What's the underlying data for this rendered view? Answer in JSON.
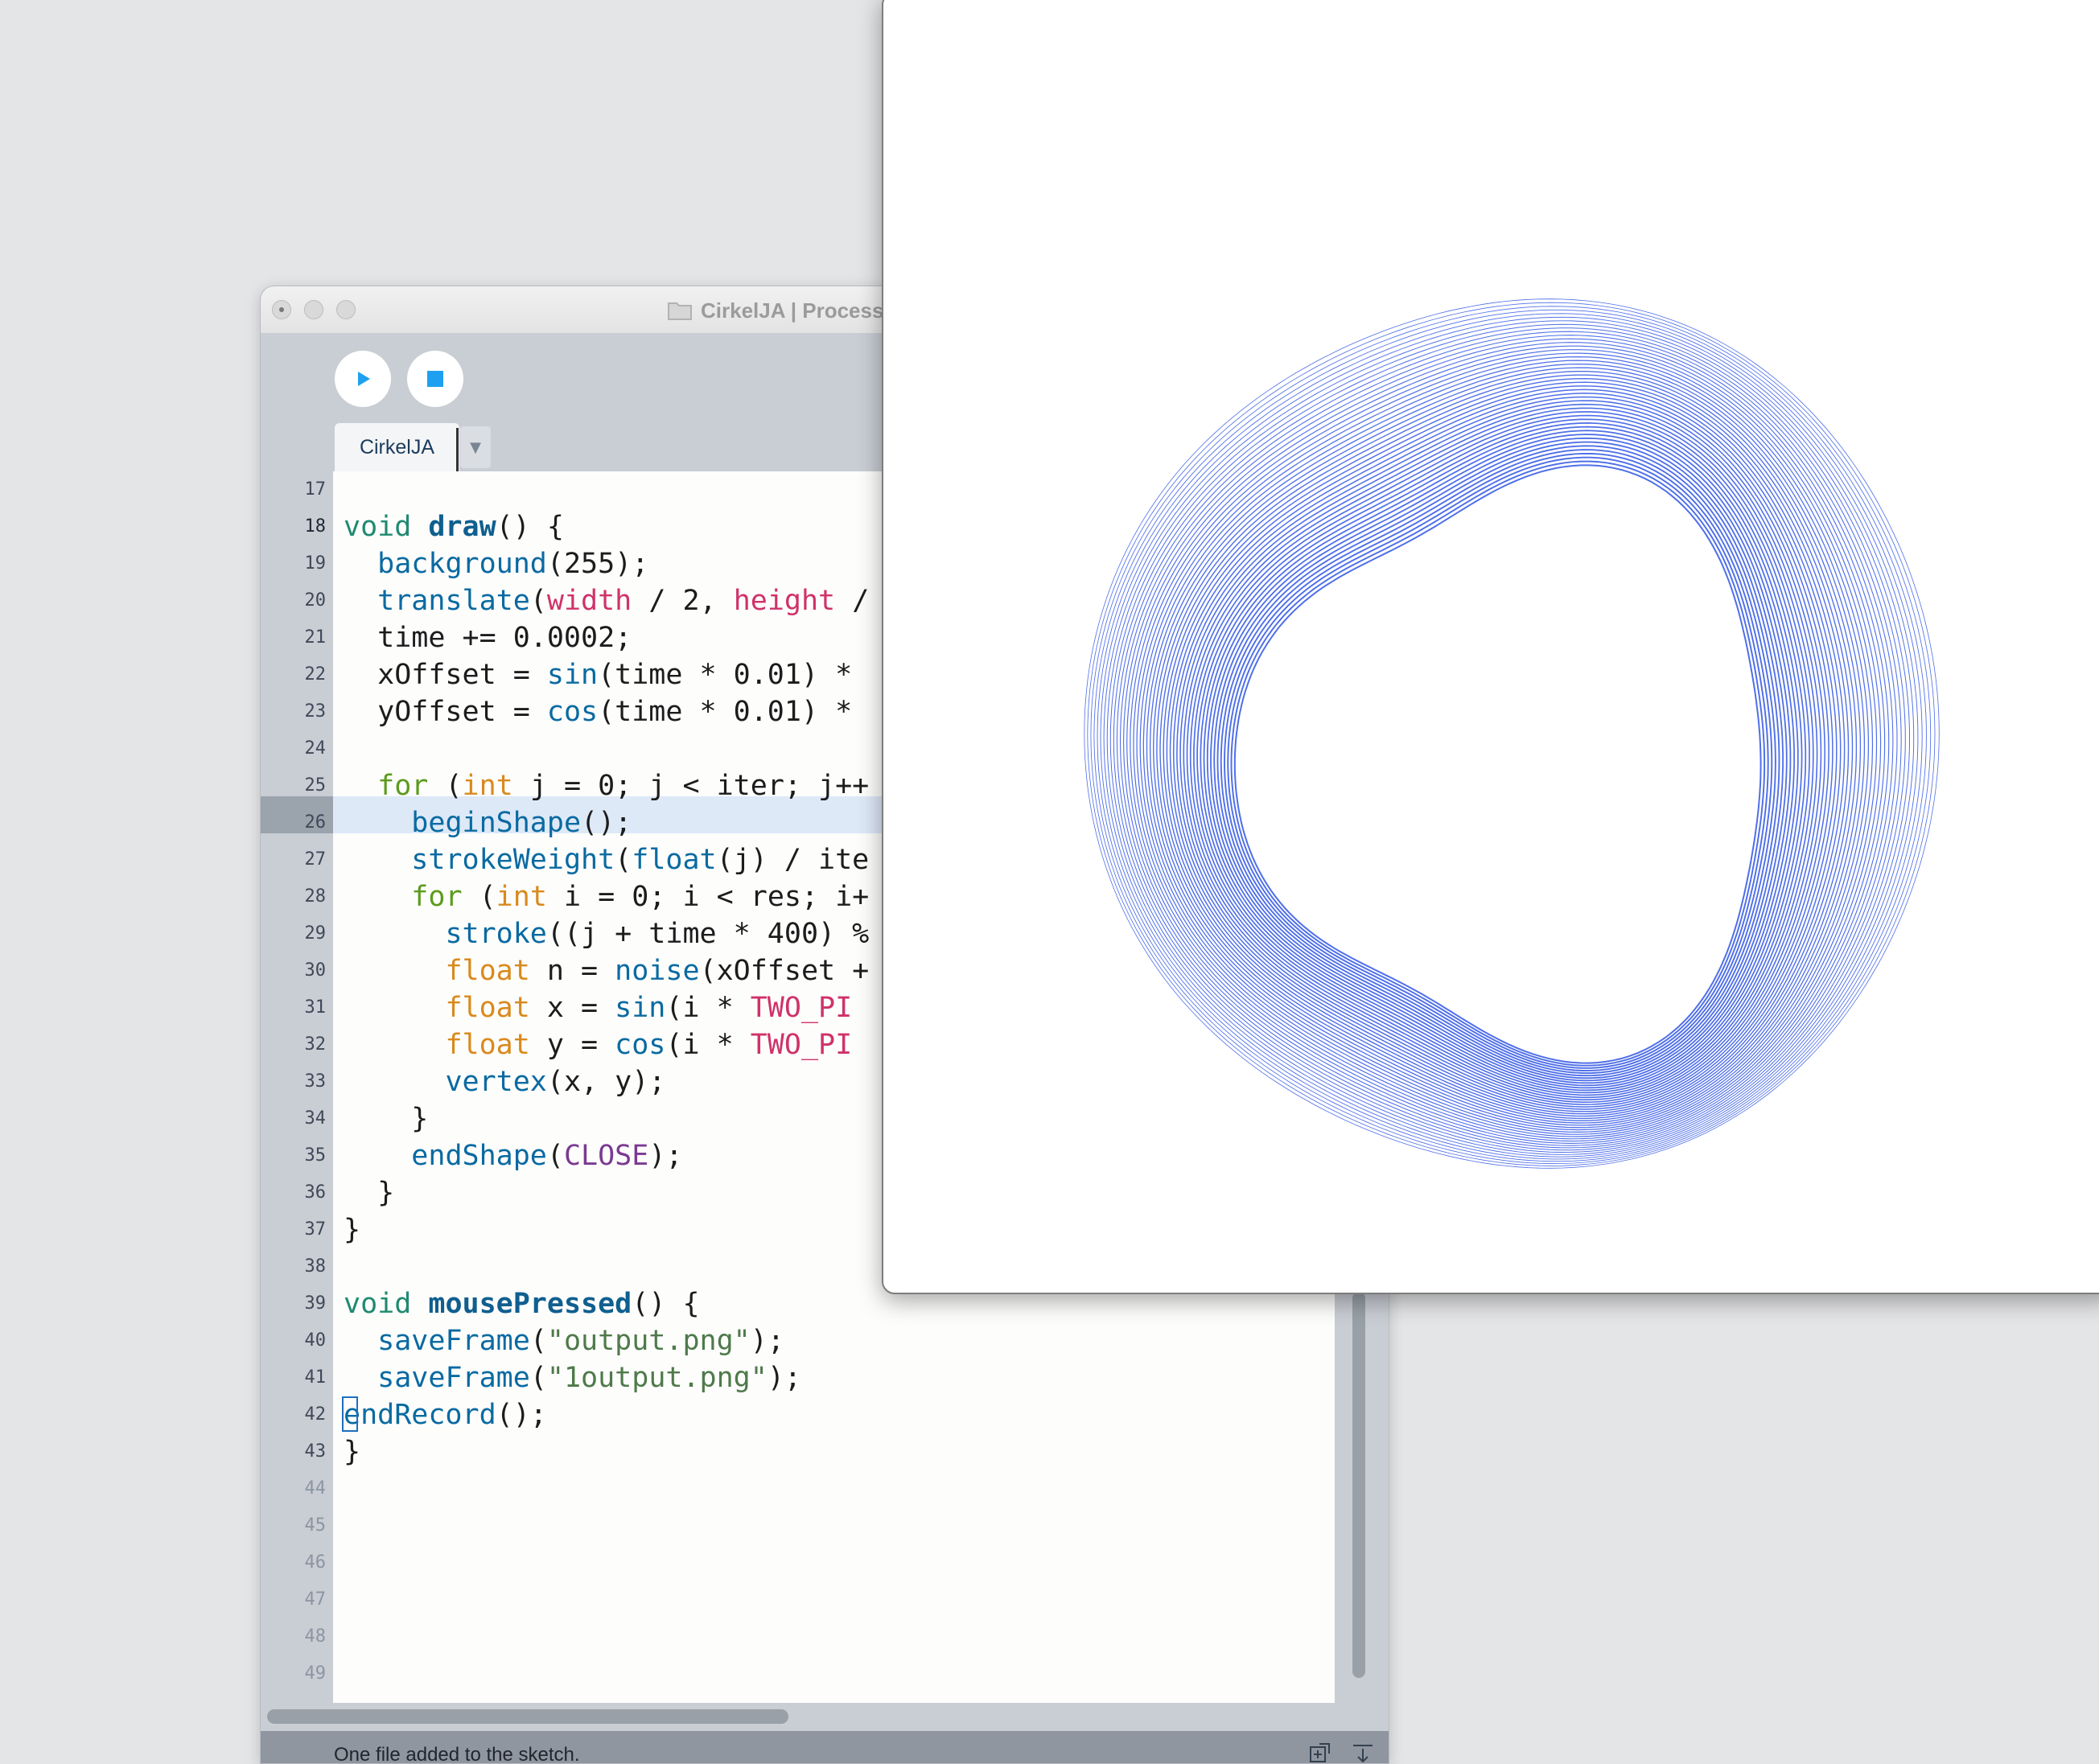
{
  "ide": {
    "window_title": "CirkelJA | Processing",
    "run_button": "run",
    "stop_button": "stop",
    "tab_label": "CirkelJA",
    "tab_menu_arrow": "▼",
    "status_text": "One file added to the sketch.",
    "line_numbers": [
      "17",
      "18",
      "19",
      "20",
      "21",
      "22",
      "23",
      "24",
      "25",
      "26",
      "27",
      "28",
      "29",
      "30",
      "31",
      "32",
      "33",
      "34",
      "35",
      "36",
      "37",
      "38",
      "39",
      "40",
      "41",
      "42",
      "43",
      "44",
      "45",
      "46",
      "47",
      "48",
      "49"
    ],
    "current_line": "18",
    "code_lines": [
      "",
      "void draw() {",
      "  background(255);",
      "  translate(width / 2, height /",
      "  time += 0.0002;",
      "  xOffset = sin(time * 0.01) *",
      "  yOffset = cos(time * 0.01) *",
      "",
      "  for (int j = 0; j < iter; j++",
      "    beginShape();",
      "    strokeWeight(float(j) / ite",
      "    for (int i = 0; i < res; i+",
      "      stroke((j + time * 400) %",
      "      float n = noise(xOffset +",
      "      float x = sin(i * TWO_PI",
      "      float y = cos(i * TWO_PI",
      "      vertex(x, y);",
      "    }",
      "    endShape(CLOSE);",
      "  }",
      "}",
      "",
      "void mousePressed() {",
      "  saveFrame(\"output.png\");",
      "  saveFrame(\"1output.png\");",
      "endRecord();",
      "}"
    ]
  },
  "sketch": {
    "stroke_color": "#4f6fe8",
    "background": "#ffffff",
    "ring_count": 46
  },
  "icons": {
    "folder": "folder-icon",
    "play": "play-icon",
    "stop": "stop-icon",
    "add_file": "add-file-icon",
    "export": "export-icon"
  },
  "colors": {
    "toolbar_bg": "#c9cdd4",
    "accent": "#1ea0f0",
    "highlight_line": "#dde9f7"
  }
}
